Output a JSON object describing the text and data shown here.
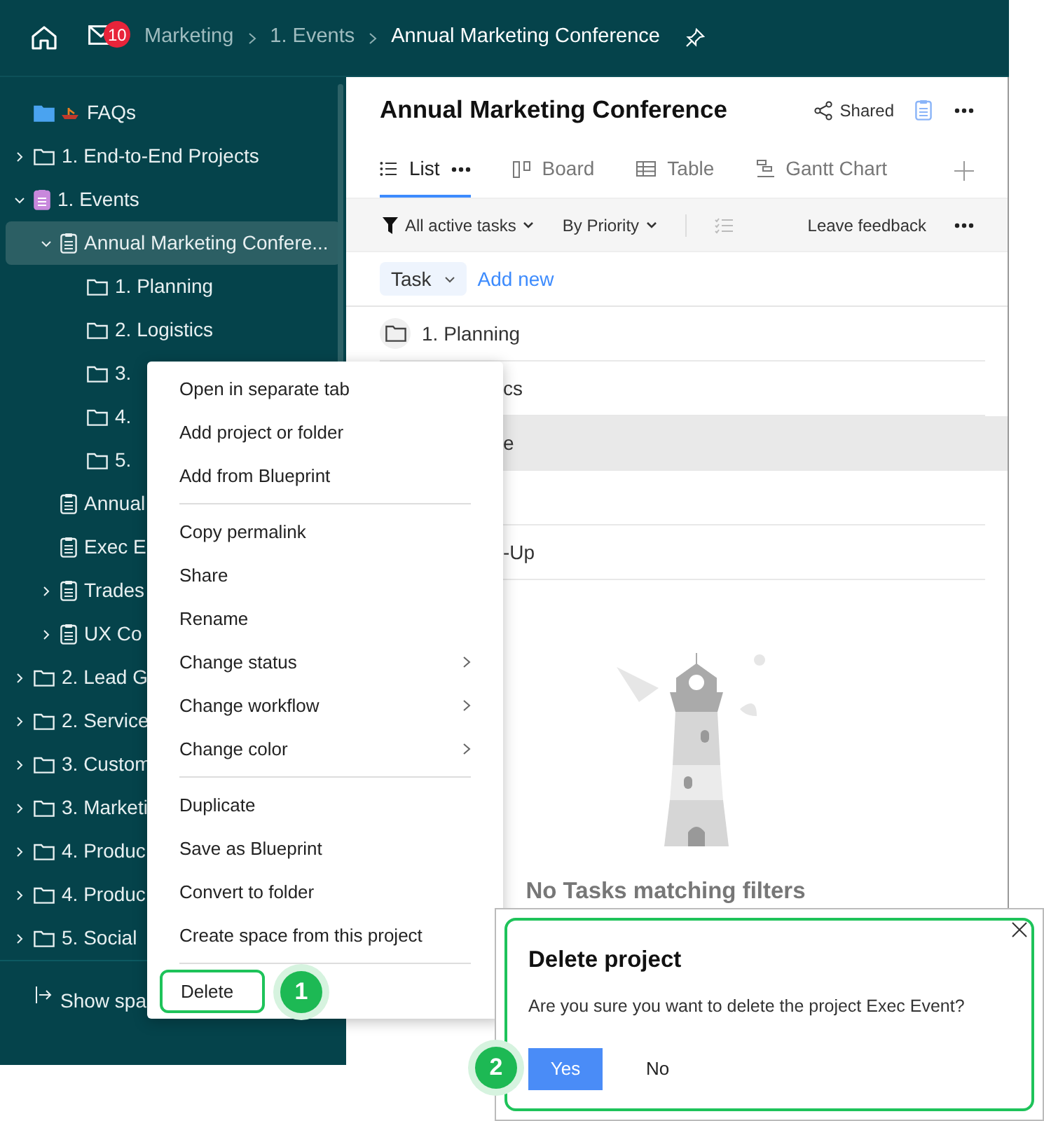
{
  "topbar": {
    "mail_badge": "10",
    "breadcrumbs": [
      {
        "label": "Marketing",
        "current": false
      },
      {
        "label": "1. Events",
        "current": false
      },
      {
        "label": "Annual Marketing Conference",
        "current": true
      }
    ]
  },
  "sidebar": {
    "items": [
      {
        "label": "FAQs",
        "kind": "faq",
        "selected": false
      },
      {
        "label": "1. End-to-End Projects",
        "kind": "folder",
        "expanded": false,
        "selected": false
      },
      {
        "label": "1. Events",
        "kind": "events",
        "expanded": true,
        "selected": false,
        "children": [
          {
            "label": "Annual Marketing Confere...",
            "kind": "project",
            "expanded": true,
            "selected": true,
            "children": [
              {
                "label": "1. Planning",
                "kind": "folder",
                "selected": false
              },
              {
                "label": "2. Logistics",
                "kind": "folder",
                "selected": false
              },
              {
                "label": "3.",
                "kind": "folder",
                "selected": false
              },
              {
                "label": "4.",
                "kind": "folder",
                "selected": false
              },
              {
                "label": "5.",
                "kind": "folder",
                "selected": false
              }
            ]
          },
          {
            "label": "Annual",
            "kind": "project",
            "selected": false
          },
          {
            "label": "Exec E",
            "kind": "project",
            "selected": false
          },
          {
            "label": "Trades",
            "kind": "project",
            "expanded": false,
            "selected": false
          },
          {
            "label": "UX Co",
            "kind": "project",
            "expanded": false,
            "selected": false
          }
        ]
      },
      {
        "label": "2. Lead G",
        "kind": "folder",
        "expanded": false,
        "selected": false
      },
      {
        "label": "2. Service",
        "kind": "folder",
        "expanded": false,
        "selected": false
      },
      {
        "label": "3. Custom",
        "kind": "folder",
        "expanded": false,
        "selected": false
      },
      {
        "label": "3. Marketi",
        "kind": "folder",
        "expanded": false,
        "selected": false
      },
      {
        "label": "4. Produc",
        "kind": "folder",
        "expanded": false,
        "selected": false
      },
      {
        "label": "4. Produc",
        "kind": "folder",
        "expanded": false,
        "selected": false
      },
      {
        "label": "5. Social",
        "kind": "folder",
        "expanded": false,
        "selected": false
      }
    ],
    "footer": "Show spa"
  },
  "project": {
    "title": "Annual Marketing Conference",
    "shared": "Shared",
    "tabs": [
      {
        "label": "List",
        "selected": true,
        "kind": "list"
      },
      {
        "label": "Board",
        "selected": false,
        "kind": "board"
      },
      {
        "label": "Table",
        "selected": false,
        "kind": "table"
      },
      {
        "label": "Gantt Chart",
        "selected": false,
        "kind": "gantt"
      }
    ],
    "filters": [
      {
        "label": "All active tasks",
        "kind": "filter"
      },
      {
        "label": "By Priority",
        "kind": "sort"
      }
    ],
    "feedback": "Leave feedback",
    "add_type": "Task",
    "add_new": "Add new",
    "rows": [
      {
        "label": "1. Planning",
        "kind": "folder",
        "highlighted": false
      },
      {
        "label": "cs",
        "kind": "covered",
        "highlighted": false
      },
      {
        "label": "e",
        "kind": "covered",
        "highlighted": true
      },
      {
        "kind": "covered",
        "highlighted": false
      },
      {
        "label": "-Up",
        "kind": "covered",
        "highlighted": false
      }
    ],
    "empty_message": "No Tasks matching filters"
  },
  "context_menu": {
    "groups": [
      [
        {
          "label": "Open in separate tab",
          "submenu": false,
          "highlighted": false
        },
        {
          "label": "Add project or folder",
          "submenu": false,
          "highlighted": false
        },
        {
          "label": "Add from Blueprint",
          "submenu": false,
          "highlighted": false
        }
      ],
      [
        {
          "label": "Copy permalink",
          "submenu": false,
          "highlighted": false
        },
        {
          "label": "Share",
          "submenu": false,
          "highlighted": false
        },
        {
          "label": "Rename",
          "submenu": false,
          "highlighted": false
        },
        {
          "label": "Change status",
          "submenu": true,
          "highlighted": false
        },
        {
          "label": "Change workflow",
          "submenu": true,
          "highlighted": false
        },
        {
          "label": "Change color",
          "submenu": true,
          "highlighted": false
        }
      ],
      [
        {
          "label": "Duplicate",
          "submenu": false,
          "highlighted": false
        },
        {
          "label": "Save as Blueprint",
          "submenu": false,
          "highlighted": false
        },
        {
          "label": "Convert to folder",
          "submenu": false,
          "highlighted": false
        },
        {
          "label": "Create space from this project",
          "submenu": false,
          "highlighted": false
        }
      ],
      [
        {
          "label": "Delete",
          "submenu": false,
          "highlighted": true,
          "callout": "1"
        }
      ]
    ]
  },
  "dialog": {
    "title": "Delete project",
    "message": "Are you sure you want to delete the project Exec Event?",
    "buttons": [
      {
        "label": "Yes",
        "kind": "primary"
      },
      {
        "label": "No",
        "kind": "plain"
      }
    ],
    "callout": "2"
  }
}
